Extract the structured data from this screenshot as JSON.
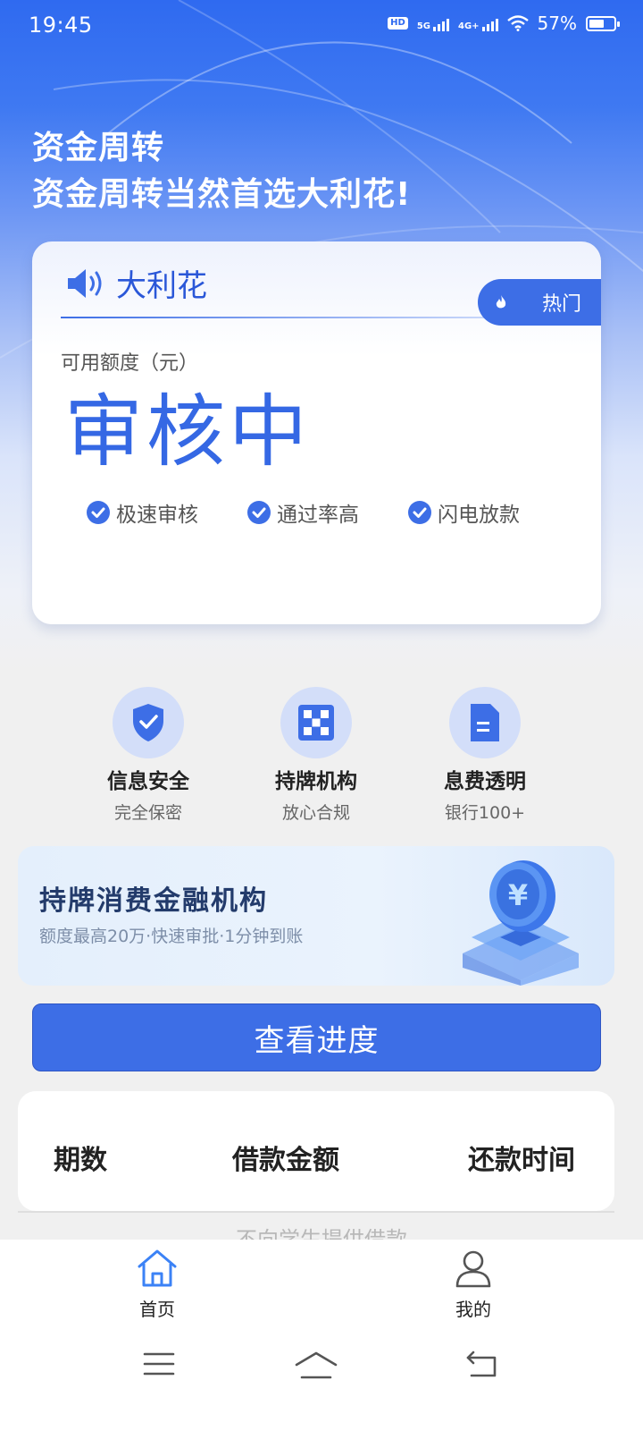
{
  "status_bar": {
    "time": "19:45",
    "hd_tag": "HD",
    "net_5g": "5G",
    "net_4g": "4G+",
    "battery": "57%"
  },
  "hero": {
    "title_line1": "资金周转",
    "title_line2": "资金周转当然首选大利花!"
  },
  "card": {
    "brand": "大利花",
    "badge": "热门",
    "quota_label": "可用额度（元）",
    "quota_value": "审核中",
    "features": [
      "极速审核",
      "通过率高",
      "闪电放款"
    ]
  },
  "trust": [
    {
      "title": "信息安全",
      "sub": "完全保密",
      "icon": "shield-check-icon"
    },
    {
      "title": "持牌机构",
      "sub": "放心合规",
      "icon": "license-grid-icon"
    },
    {
      "title": "息费透明",
      "sub": "银行100+",
      "icon": "document-icon"
    }
  ],
  "banner": {
    "title": "持牌消费金融机构",
    "subtitle": "额度最高20万·快速审批·1分钟到账",
    "icon": "coin-stack-icon"
  },
  "progress_button": "查看进度",
  "table": {
    "headers": [
      "期数",
      "借款金额",
      "还款时间"
    ]
  },
  "notice": "不向学生提供借款",
  "tabbar": {
    "items": [
      {
        "label": "首页",
        "icon": "home-icon",
        "active": true
      },
      {
        "label": "我的",
        "icon": "user-icon",
        "active": false
      }
    ]
  },
  "colors": {
    "primary": "#3d6ee6",
    "brand_text": "#2a57d8",
    "active_tab": "#3b82f6",
    "background": "#f0f0f0"
  }
}
